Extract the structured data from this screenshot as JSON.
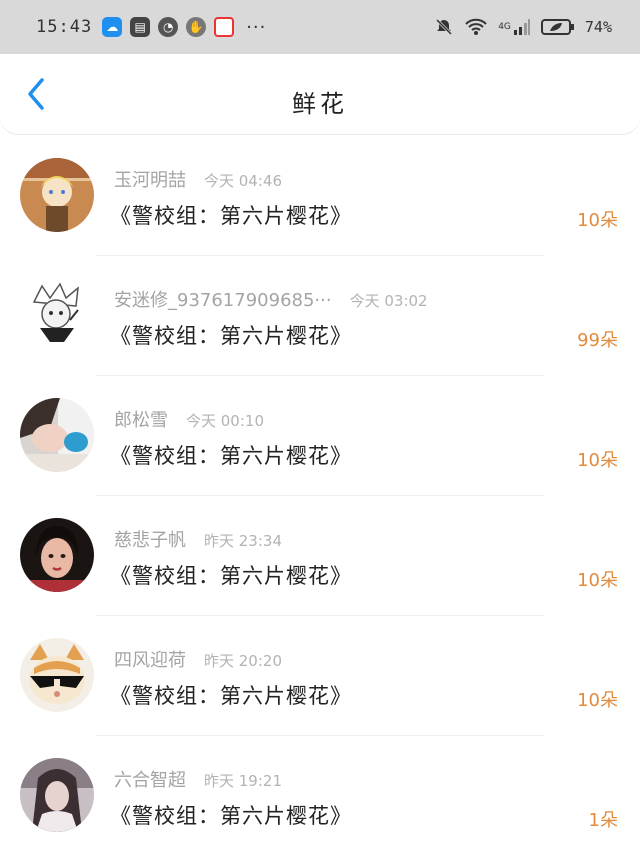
{
  "status_bar": {
    "time": "15:43",
    "more": "···",
    "network": "4G",
    "battery": "74%"
  },
  "header": {
    "title": "鲜花"
  },
  "gifts": [
    {
      "name": "玉河明喆",
      "time": "今天 04:46",
      "message": "《警校组：第六片樱花》",
      "count": "10朵"
    },
    {
      "name": "安迷修_937617909685···",
      "time": "今天 03:02",
      "message": "《警校组：第六片樱花》",
      "count": "99朵"
    },
    {
      "name": "郎松雪",
      "time": "今天 00:10",
      "message": "《警校组：第六片樱花》",
      "count": "10朵"
    },
    {
      "name": "慈悲子帆",
      "time": "昨天 23:34",
      "message": "《警校组：第六片樱花》",
      "count": "10朵"
    },
    {
      "name": "四风迎荷",
      "time": "昨天 20:20",
      "message": "《警校组：第六片樱花》",
      "count": "10朵"
    },
    {
      "name": "六合智超",
      "time": "昨天 19:21",
      "message": "《警校组：第六片樱花》",
      "count": "1朵"
    }
  ],
  "colors": {
    "accent": "#1f8ff0",
    "count": "#e48a3a"
  }
}
